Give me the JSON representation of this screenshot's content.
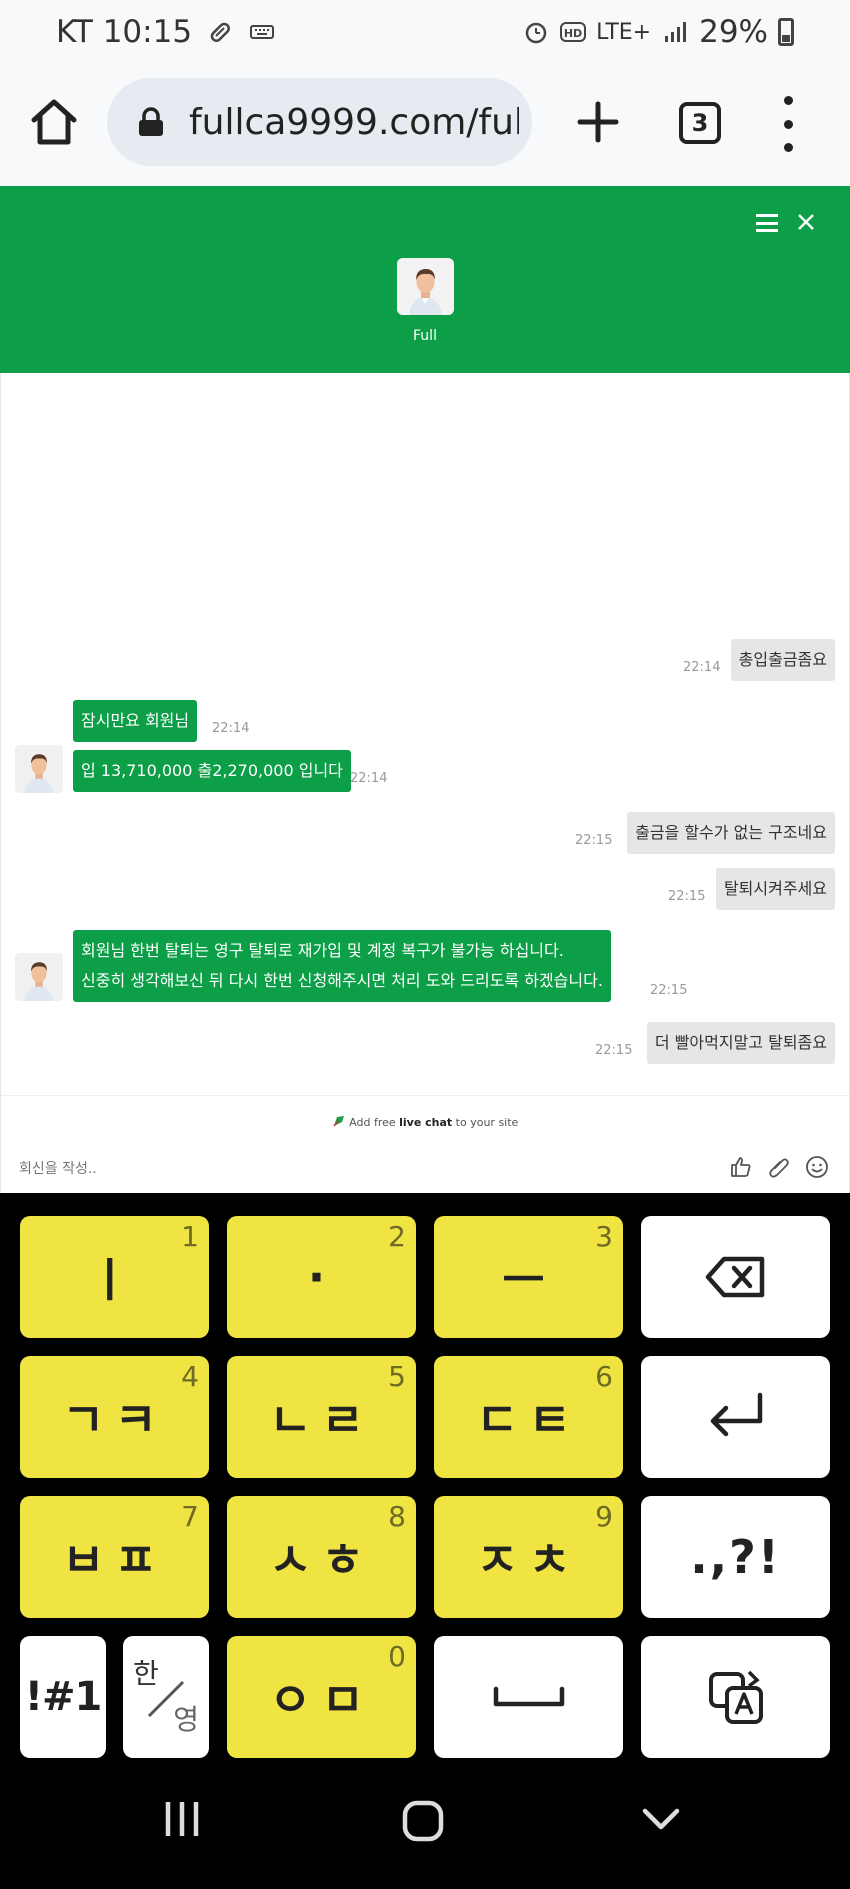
{
  "status_bar": {
    "carrier_time": "KT 10:15",
    "network": "LTE+",
    "battery": "29%"
  },
  "browser": {
    "url": "fullca9999.com/full_",
    "tab_count": "3"
  },
  "chat": {
    "agent_name": "Full",
    "messages": [
      {
        "dir": "out",
        "text": "총입출금좀요",
        "time": "22:14"
      },
      {
        "dir": "in",
        "text": "잠시만요 회원님",
        "time": "22:14"
      },
      {
        "dir": "in",
        "text": "입 13,710,000 출2,270,000 입니다",
        "time": "22:14"
      },
      {
        "dir": "out",
        "text": "출금을 할수가 없는 구조네요",
        "time": "22:15"
      },
      {
        "dir": "out",
        "text": "탈퇴시켜주세요",
        "time": "22:15"
      },
      {
        "dir": "in",
        "text": "회원님 한번 탈퇴는 영구 탈퇴로 재가입 및 계정 복구가 불가능 하십니다.",
        "text2": "신중히 생각해보신 뒤 다시 한번 신청해주시면 처리 도와 드리도록 하겠습니다.",
        "time": "22:15"
      },
      {
        "dir": "out",
        "text": "더 빨아먹지말고 탈퇴좀요",
        "time": "22:15"
      }
    ],
    "powered_by_prefix": "Add free ",
    "powered_by_bold": "live chat",
    "powered_by_suffix": " to your site",
    "compose_placeholder": "회신을 작성.."
  },
  "keyboard": {
    "keys": [
      {
        "label": "ㅣ",
        "num": "1"
      },
      {
        "label": "·",
        "num": "2"
      },
      {
        "label": "ㅡ",
        "num": "3"
      },
      {
        "label": "ㄱㅋ",
        "num": "4"
      },
      {
        "label": "ㄴㄹ",
        "num": "5"
      },
      {
        "label": "ㄷㅌ",
        "num": "6"
      },
      {
        "label": "ㅂㅍ",
        "num": "7"
      },
      {
        "label": "ㅅㅎ",
        "num": "8"
      },
      {
        "label": "ㅈㅊ",
        "num": "9"
      },
      {
        "label": "ㅇㅁ",
        "num": "0"
      }
    ],
    "punct_label": ".,?!",
    "symbols_label": "!#1",
    "lang_top": "한",
    "lang_bottom": "영"
  }
}
